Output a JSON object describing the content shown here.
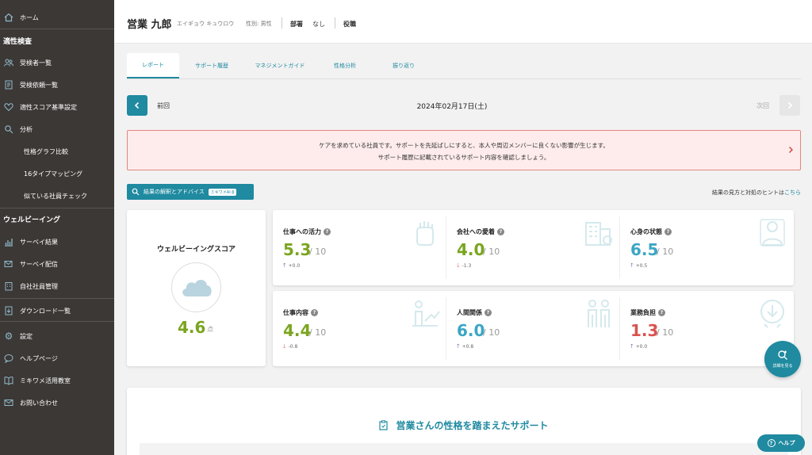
{
  "sidebar": {
    "home": "ホーム",
    "section_aptitude": "適性検査",
    "examinees": "受検者一覧",
    "requests": "受検依頼一覧",
    "score_settings": "適性スコア基準設定",
    "analysis": "分析",
    "personality_compare": "性格グラフ比較",
    "type_mapping": "16タイプマッピング",
    "similar_check": "似ている社員チェック",
    "section_wellbeing": "ウェルビーイング",
    "survey_results": "サーベイ結果",
    "survey_delivery": "サーベイ配信",
    "employee_mgmt": "自社社員管理",
    "downloads": "ダウンロード一覧",
    "settings": "設定",
    "help_page": "ヘルプページ",
    "classroom": "ミキワメ活用教室",
    "contact": "お問い合わせ"
  },
  "header": {
    "name": "営業 九郎",
    "kana": "エイギョウ キュウロウ",
    "gender": "性別: 男性",
    "dept_label": "部署",
    "dept_value": "なし",
    "role_label": "役職"
  },
  "tabs": [
    "レポート",
    "サポート履歴",
    "マネジメントガイド",
    "性格分析",
    "振り返り"
  ],
  "date_nav": {
    "prev": "前回",
    "date": "2024年02月17日(土)",
    "next": "次回"
  },
  "alert": {
    "line1": "ケアを求めている社員です。サポートを先延ばしにすると、本人や周辺メンバーに良くない影響が生じます。",
    "line2": "サポート履歴に記載されているサポート内容を確認しましょう。"
  },
  "advice_button": {
    "label": "結果の解釈とアドバイス",
    "badge": "ミキワメAI β"
  },
  "hint": {
    "text": "結果の見方と対処のヒントは",
    "link": "こちら"
  },
  "wellbeing": {
    "title": "ウェルビーイングスコア",
    "score": "4.6",
    "unit": "点",
    "icon": "cloud-icon"
  },
  "metrics": [
    {
      "label": "仕事への活力",
      "value": "5.3",
      "den": "/ 10",
      "delta": "+0.0",
      "dir": "up",
      "color": "#7aa51f",
      "icon": "fist-icon"
    },
    {
      "label": "会社への愛着",
      "value": "4.0",
      "den": "/ 10",
      "delta": "-1.3",
      "dir": "down",
      "color": "#7aa51f",
      "icon": "building-icon"
    },
    {
      "label": "心身の状態",
      "value": "6.5",
      "den": "/ 10",
      "delta": "+0.5",
      "dir": "up",
      "color": "#3ba6c4",
      "icon": "person-icon"
    },
    {
      "label": "仕事内容",
      "value": "4.4",
      "den": "/ 10",
      "delta": "-0.8",
      "dir": "down",
      "color": "#7aa51f",
      "icon": "growth-icon"
    },
    {
      "label": "人間関係",
      "value": "6.0",
      "den": "/ 10",
      "delta": "+0.8",
      "dir": "up",
      "color": "#3ba6c4",
      "icon": "people-icon"
    },
    {
      "label": "業務負担",
      "value": "1.3",
      "den": "/ 10",
      "delta": "+0.0",
      "dir": "up",
      "color": "#d9534f",
      "icon": "stress-icon"
    }
  ],
  "details_fab": "詳細を見る",
  "support_title": "営業さんの性格を踏まえたサポート",
  "help_button": "ヘルプ",
  "colors": {
    "accent": "#1f8aa0",
    "sidebar": "#3c3836",
    "alert_bg": "#fdeceb",
    "alert_border": "#e48580"
  }
}
